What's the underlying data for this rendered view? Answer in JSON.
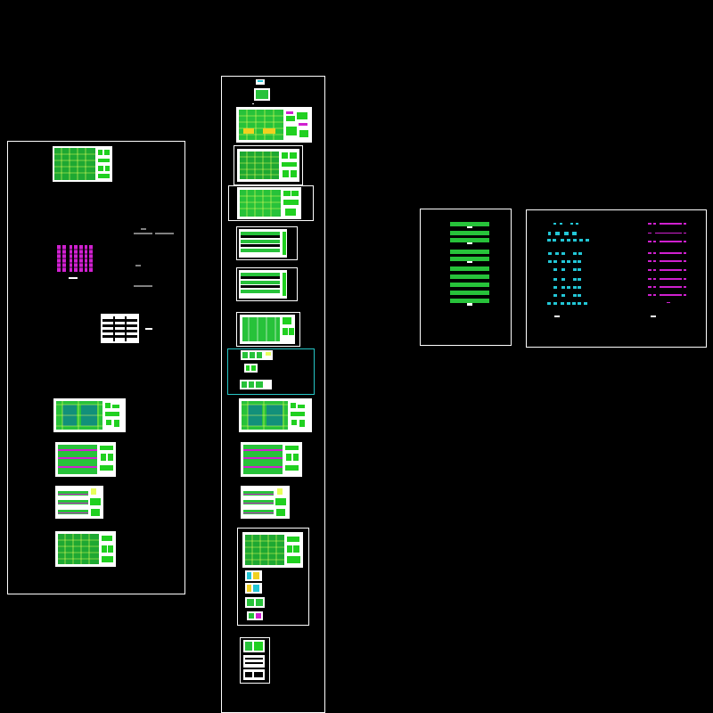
{
  "viewport": {
    "background": "#000000"
  },
  "colors": {
    "frame": "#ffffff",
    "frame_highlight": "#26c6c6",
    "plan_fill": "#27c23a",
    "plan_line": "#e8ff5a",
    "sheet_bg": "#ffffff",
    "detail_green": "#20d020",
    "magenta": "#d020d0",
    "cyan": "#22c6d6",
    "teal_fill": "#12907a"
  },
  "sheet_groups": [
    {
      "id": "left-sheet-set",
      "sheets": [
        {
          "kind": "plan-green",
          "detail": "grid"
        },
        {
          "kind": "magenta-table"
        },
        {
          "kind": "small-table"
        },
        {
          "kind": "plan-teal"
        },
        {
          "kind": "plan-striped"
        },
        {
          "kind": "plan-bands"
        },
        {
          "kind": "plan-green",
          "detail": "grid"
        }
      ]
    },
    {
      "id": "center-sheet-set",
      "sheets": [
        {
          "kind": "title-block"
        },
        {
          "kind": "plan-green",
          "detail": "grid-yellow"
        },
        {
          "kind": "plan-green",
          "detail": "grid"
        },
        {
          "kind": "plan-green",
          "detail": "grid"
        },
        {
          "kind": "plan-bands"
        },
        {
          "kind": "plan-bands"
        },
        {
          "kind": "plan-green",
          "detail": "sparse"
        },
        {
          "kind": "detail-group"
        },
        {
          "kind": "plan-teal"
        },
        {
          "kind": "plan-striped"
        },
        {
          "kind": "plan-bands"
        },
        {
          "kind": "plan-green",
          "detail": "grid"
        },
        {
          "kind": "detail-column"
        }
      ]
    },
    {
      "id": "right-sheet-green",
      "sheets": [
        {
          "kind": "section-stack"
        }
      ]
    },
    {
      "id": "right-sheet-schedule",
      "sheets": [
        {
          "kind": "cross-marks"
        }
      ]
    }
  ]
}
